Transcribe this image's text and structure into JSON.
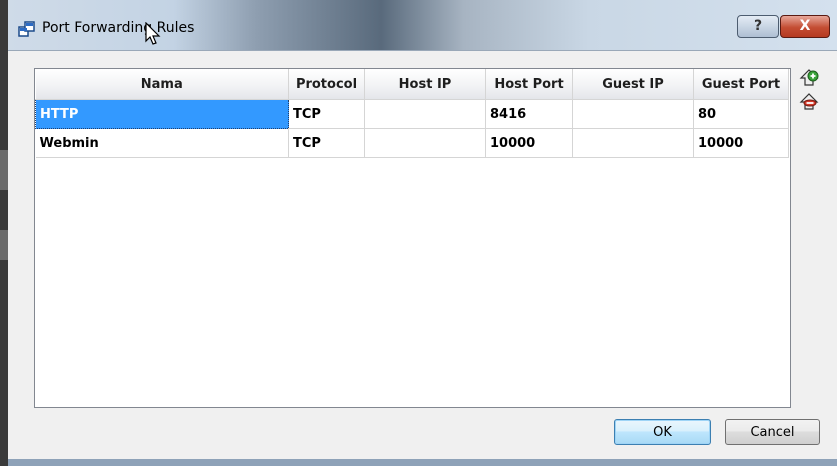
{
  "window": {
    "title": "Port Forwarding Rules",
    "title_icon": "port-forwarding-icon",
    "help_label": "?",
    "close_label": "X"
  },
  "table": {
    "columns": [
      "Nama",
      "Protocol",
      "Host IP",
      "Host Port",
      "Guest IP",
      "Guest Port"
    ],
    "rows": [
      {
        "name": "HTTP",
        "protocol": "TCP",
        "host_ip": "",
        "host_port": "8416",
        "guest_ip": "",
        "guest_port": "80"
      },
      {
        "name": "Webmin",
        "protocol": "TCP",
        "host_ip": "",
        "host_port": "10000",
        "guest_ip": "",
        "guest_port": "10000"
      }
    ],
    "selected_row": 0
  },
  "side_actions": {
    "add_icon": "add-rule-icon",
    "remove_icon": "remove-rule-icon"
  },
  "buttons": {
    "ok_label": "OK",
    "cancel_label": "Cancel"
  },
  "colors": {
    "selection": "#3399ff",
    "close_button": "#c44d33"
  }
}
